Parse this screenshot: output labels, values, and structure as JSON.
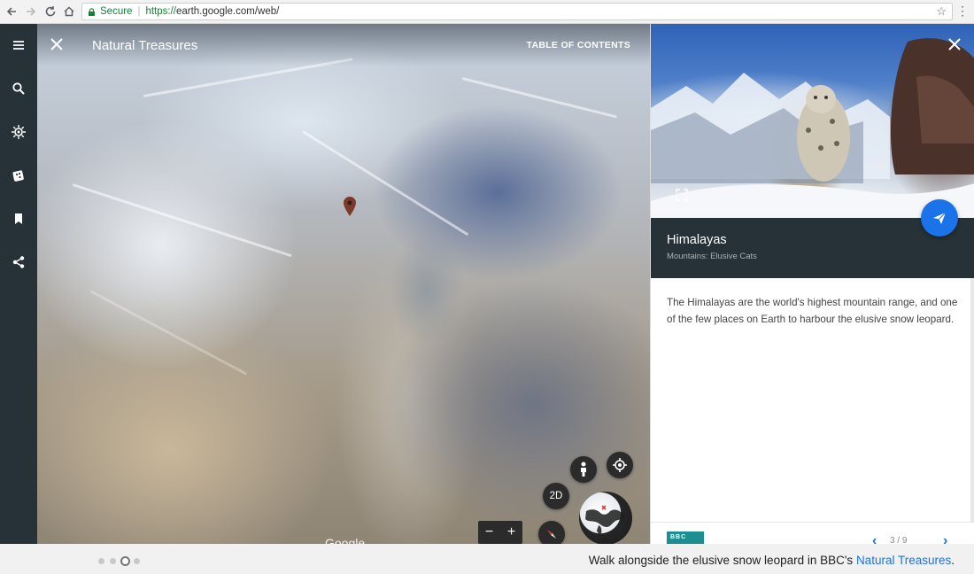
{
  "browser": {
    "secure_label": "Secure",
    "url_protocol": "https://",
    "url_rest": "earth.google.com/web/"
  },
  "map": {
    "title": "Natural Treasures",
    "toc_label": "TABLE OF CONTENTS",
    "view_mode": "2D",
    "zoom_out": "−",
    "zoom_in": "+",
    "google_mark": "Google"
  },
  "panel": {
    "title": "Himalayas",
    "subtitle": "Mountains: Elusive Cats",
    "description": "The Himalayas are the world's highest mountain range, and one of the few places on Earth to harbour the elusive snow leopard.",
    "logo_text": "BBC",
    "pager": "3 / 9",
    "accent": "#1a73e8",
    "header_bg": "#263238"
  },
  "caption": {
    "prefix": "Walk alongside the elusive snow leopard in BBC's ",
    "link": "Natural Treasures",
    "suffix": "."
  },
  "carousel": {
    "active_index": 2,
    "count": 4
  }
}
